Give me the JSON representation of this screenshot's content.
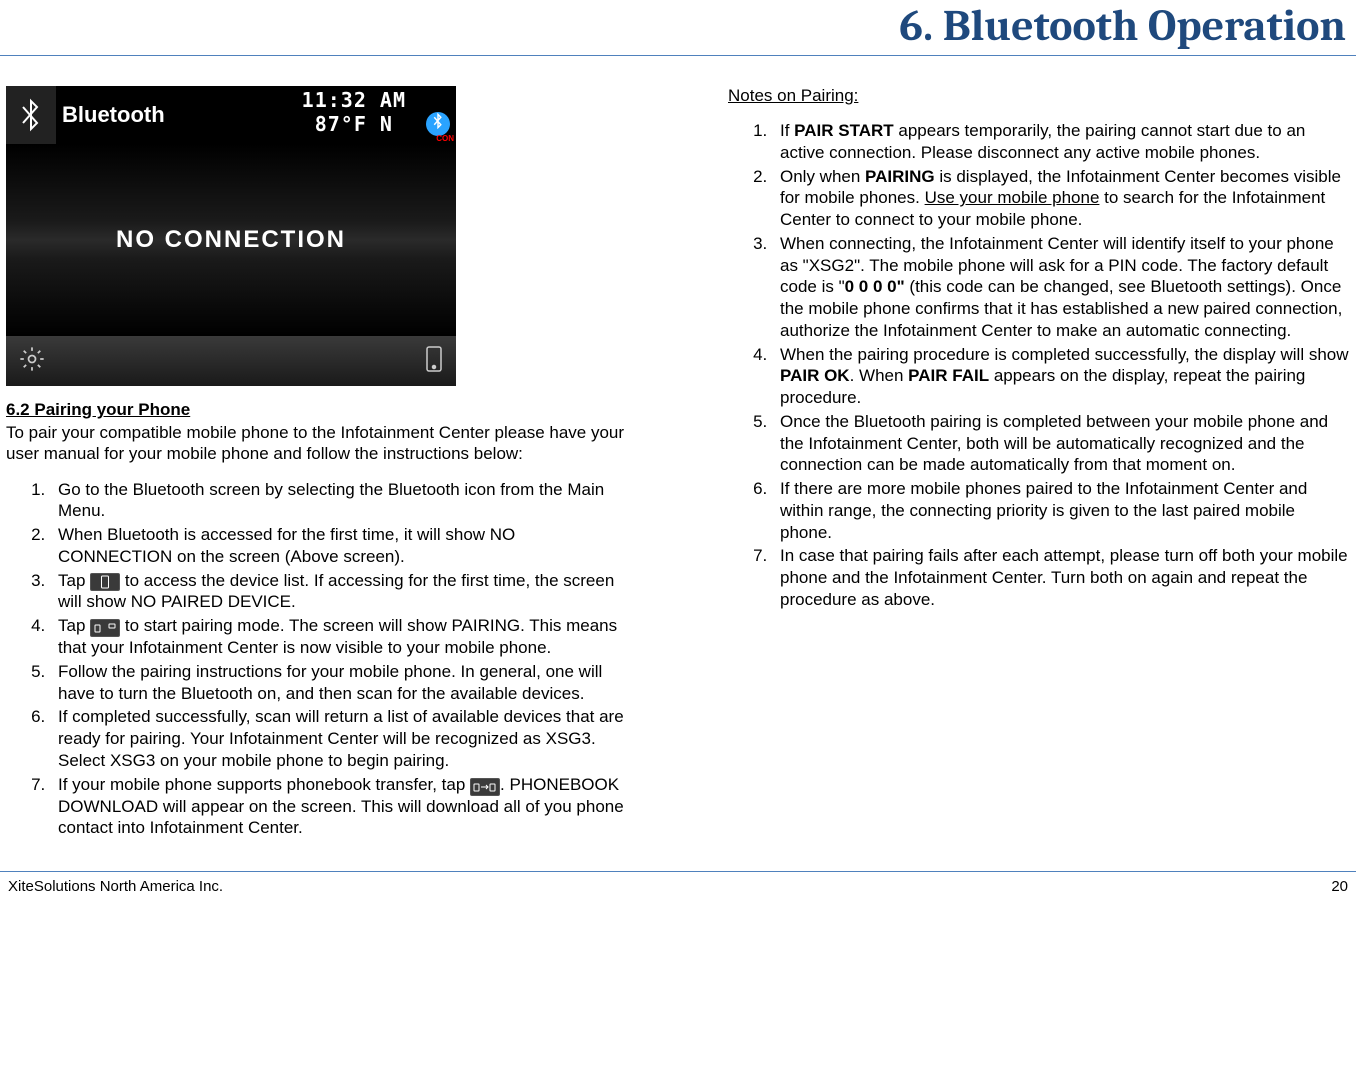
{
  "page_title": "6. Bluetooth Operation",
  "screenshot": {
    "bt_label": "Bluetooth",
    "time": "11:32 AM",
    "temp": "87°F  N",
    "con": "CON",
    "body": "NO  CONNECTION"
  },
  "left": {
    "section_heading": "6.2  Pairing your Phone",
    "intro": "To pair your compatible mobile phone to the Infotainment Center please have your user manual for your mobile phone and follow the instructions below:",
    "steps": [
      "Go to the Bluetooth screen by selecting the Bluetooth icon from the Main Menu.",
      "When Bluetooth is accessed for the first time, it will show NO CONNECTION on the screen (Above screen).",
      {
        "pre": "Tap ",
        "post": " to access the device list. If accessing for the first time, the screen will show NO PAIRED DEVICE.",
        "icon": "phone-small-icon"
      },
      {
        "pre": "Tap ",
        "post": " to start pairing mode. The screen will show PAIRING. This means that your Infotainment Center is now visible to your mobile phone.",
        "icon": "pair-small-icon"
      },
      "Follow the pairing instructions for your mobile phone. In general, one will have to turn the Bluetooth on, and then scan for the available devices.",
      "If completed successfully, scan will return a list of available devices that are ready for pairing. Your Infotainment Center will be recognized as XSG3. Select XSG3 on your mobile phone to begin pairing.",
      {
        "pre": "If your mobile phone supports phonebook transfer, tap ",
        "post": ". PHONEBOOK DOWNLOAD will appear on the screen. This will download all of you phone contact into Infotainment Center.",
        "icon": "transfer-small-icon"
      }
    ]
  },
  "right": {
    "notes_heading": "Notes on Pairing:",
    "notes": [
      {
        "segments": [
          {
            "t": "If "
          },
          {
            "t": "PAIR START",
            "b": true
          },
          {
            "t": " appears temporarily, the pairing cannot start due to an active connection. Please disconnect any active mobile phones."
          }
        ]
      },
      {
        "segments": [
          {
            "t": "Only when "
          },
          {
            "t": "PAIRING",
            "b": true
          },
          {
            "t": " is displayed, the Infotainment Center becomes visible for mobile phones. "
          },
          {
            "t": "Use your mobile phone",
            "u": true
          },
          {
            "t": " to search for the Infotainment Center to connect to your mobile phone."
          }
        ]
      },
      {
        "segments": [
          {
            "t": "When connecting, the Infotainment Center will identify itself to your phone as \"XSG2\". The mobile phone will ask for a PIN code. The factory default code is \""
          },
          {
            "t": "0 0 0 0\"",
            "b": true
          },
          {
            "t": " (this code can be changed, see Bluetooth settings). Once the mobile phone confirms that it has established a new paired connection, authorize the Infotainment Center to make an automatic connecting."
          }
        ]
      },
      {
        "segments": [
          {
            "t": "When the pairing procedure is completed successfully, the display will show "
          },
          {
            "t": "PAIR OK",
            "b": true
          },
          {
            "t": ". When "
          },
          {
            "t": "PAIR FAIL",
            "b": true
          },
          {
            "t": " appears on the display, repeat the pairing procedure."
          }
        ]
      },
      {
        "segments": [
          {
            "t": "Once the Bluetooth pairing is completed between your mobile phone and the Infotainment Center, both will be automatically recognized and the connection can be made automatically from that moment on."
          }
        ]
      },
      {
        "segments": [
          {
            "t": "If there are more mobile phones paired to the Infotainment Center and within range, the connecting priority is given to the last paired mobile phone."
          }
        ]
      },
      {
        "segments": [
          {
            "t": "In case that pairing fails after each attempt, please turn off both your mobile phone and the Infotainment Center. Turn both on again and repeat the procedure as above."
          }
        ]
      }
    ]
  },
  "footer": {
    "company": "XiteSolutions North America Inc.",
    "page": "20"
  }
}
